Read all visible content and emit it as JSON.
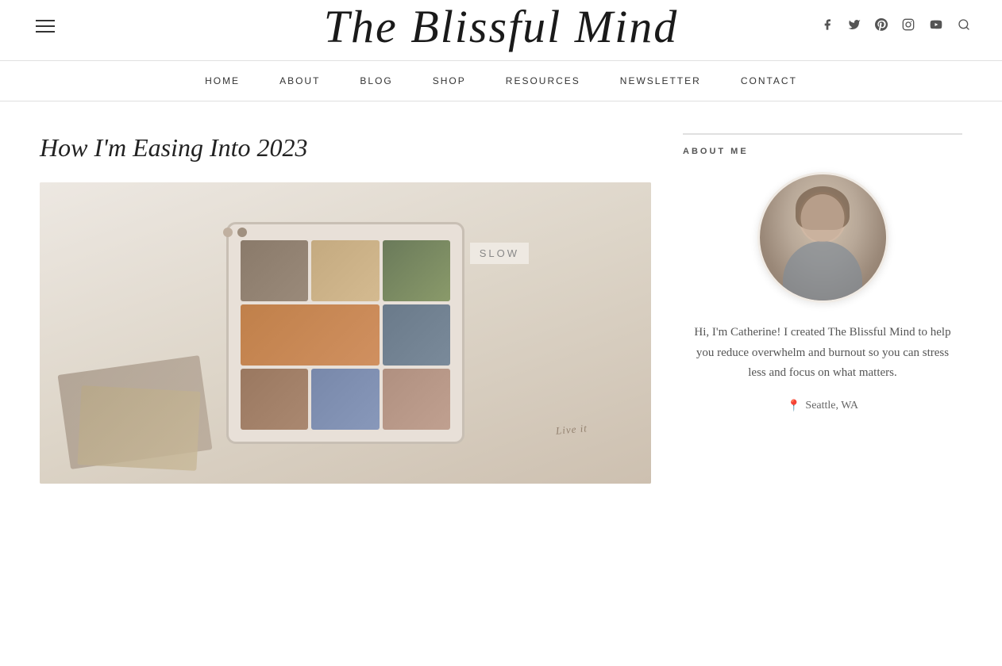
{
  "header": {
    "logo_text": "The Blissful Mind",
    "hamburger_label": "Menu"
  },
  "social_icons": [
    {
      "name": "facebook",
      "symbol": "f",
      "label": "facebook-icon"
    },
    {
      "name": "twitter",
      "symbol": "t",
      "label": "twitter-icon"
    },
    {
      "name": "pinterest",
      "symbol": "p",
      "label": "pinterest-icon"
    },
    {
      "name": "instagram",
      "symbol": "i",
      "label": "instagram-icon"
    },
    {
      "name": "youtube",
      "symbol": "y",
      "label": "youtube-icon"
    },
    {
      "name": "search",
      "symbol": "s",
      "label": "search-icon"
    }
  ],
  "nav": {
    "items": [
      {
        "label": "HOME",
        "key": "home"
      },
      {
        "label": "ABOUT",
        "key": "about"
      },
      {
        "label": "BLOG",
        "key": "blog"
      },
      {
        "label": "SHOP",
        "key": "shop"
      },
      {
        "label": "RESOURCES",
        "key": "resources"
      },
      {
        "label": "NEWSLETTER",
        "key": "newsletter"
      },
      {
        "label": "CONTACT",
        "key": "contact"
      }
    ]
  },
  "article": {
    "title": "How I'm Easing Into 2023",
    "image_alt": "Mood board with photos on tablet showing slow living aesthetic",
    "slow_label": "SLOW"
  },
  "sidebar": {
    "about_me_title": "ABOUT ME",
    "avatar_alt": "Catherine - author photo",
    "description": "Hi, I'm Catherine! I created The Blissful Mind to help you reduce overwhelm and burnout so you can stress less and focus on what matters.",
    "location": "Seattle, WA",
    "location_icon": "📍"
  }
}
